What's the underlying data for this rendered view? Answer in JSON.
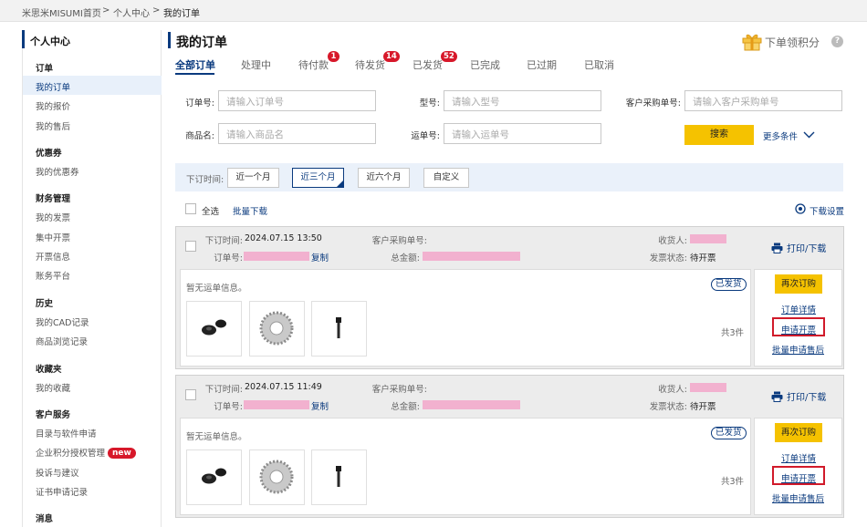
{
  "breadcrumb": {
    "home": "米思米MISUMI首页",
    "sep": ">",
    "center": "个人中心",
    "current": "我的订单"
  },
  "sidebar": {
    "title": "个人中心",
    "sections": [
      {
        "title": "订单",
        "items": [
          "我的订单",
          "我的报价",
          "我的售后"
        ]
      },
      {
        "title": "优惠券",
        "items": [
          "我的优惠券"
        ]
      },
      {
        "title": "财务管理",
        "items": [
          "我的发票",
          "集中开票",
          "开票信息",
          "账务平台"
        ]
      },
      {
        "title": "历史",
        "items": [
          "我的CAD记录",
          "商品浏览记录"
        ]
      },
      {
        "title": "收藏夹",
        "items": [
          "我的收藏"
        ]
      },
      {
        "title": "客户服务",
        "items": [
          "目录与软件申请",
          "企业积分授权管理",
          "投诉与建议",
          "证书申请记录"
        ]
      },
      {
        "title": "消息",
        "items": []
      }
    ],
    "new_badge": "new"
  },
  "main": {
    "title": "我的订单",
    "points": "下单领积分",
    "help": "?",
    "tabs": [
      {
        "label": "全部订单",
        "count": ""
      },
      {
        "label": "处理中",
        "count": ""
      },
      {
        "label": "待付款",
        "count": "1"
      },
      {
        "label": "待发货",
        "count": "14"
      },
      {
        "label": "已发货",
        "count": "52"
      },
      {
        "label": "已完成",
        "count": ""
      },
      {
        "label": "已过期",
        "count": ""
      },
      {
        "label": "已取消",
        "count": ""
      }
    ]
  },
  "filters": {
    "order_no_label": "订单号:",
    "order_no_ph": "请输入订单号",
    "model_label": "型号:",
    "model_ph": "请输入型号",
    "cust_po_label": "客户采购单号:",
    "cust_po_ph": "请输入客户采购单号",
    "product_label": "商品名:",
    "product_ph": "请输入商品名",
    "waybill_label": "运单号:",
    "waybill_ph": "请输入运单号",
    "search": "搜索",
    "more": "更多条件"
  },
  "timefilter": {
    "label": "下订时间:",
    "options": [
      "近一个月",
      "近三个月",
      "近六个月",
      "自定义"
    ],
    "selected": "近三个月"
  },
  "bulk": {
    "select_all": "全选",
    "batch_download": "批量下载",
    "download_settings": "下载设置"
  },
  "orders": [
    {
      "time_label": "下订时间:",
      "time": "2024.07.15 13:50",
      "po_label": "客户采购单号:",
      "receiver_label": "收货人:",
      "order_label": "订单号:",
      "copy": "复制",
      "amount_label": "总金额:",
      "invoice_label": "发票状态:",
      "invoice_status": "待开票",
      "print": "打印/下载",
      "no_shipping": "暂无运单信息。",
      "ship_badge": "已发货",
      "total": "共3件",
      "reorder": "再次订购",
      "detail": "订单详情",
      "apply_invoice": "申请开票",
      "batch_aftersale": "批量申请售后"
    },
    {
      "time_label": "下订时间:",
      "time": "2024.07.15 11:49",
      "po_label": "客户采购单号:",
      "receiver_label": "收货人:",
      "order_label": "订单号:",
      "copy": "复制",
      "amount_label": "总金额:",
      "invoice_label": "发票状态:",
      "invoice_status": "待开票",
      "print": "打印/下载",
      "no_shipping": "暂无运单信息。",
      "ship_badge": "已发货",
      "total": "共3件",
      "reorder": "再次订购",
      "detail": "订单详情",
      "apply_invoice": "申请开票",
      "batch_aftersale": "批量申请售后"
    }
  ],
  "colors": {
    "brand": "#0a3a7e",
    "accent": "#f5c200",
    "badge": "#d7182a",
    "redact": "#f2b1cf"
  }
}
